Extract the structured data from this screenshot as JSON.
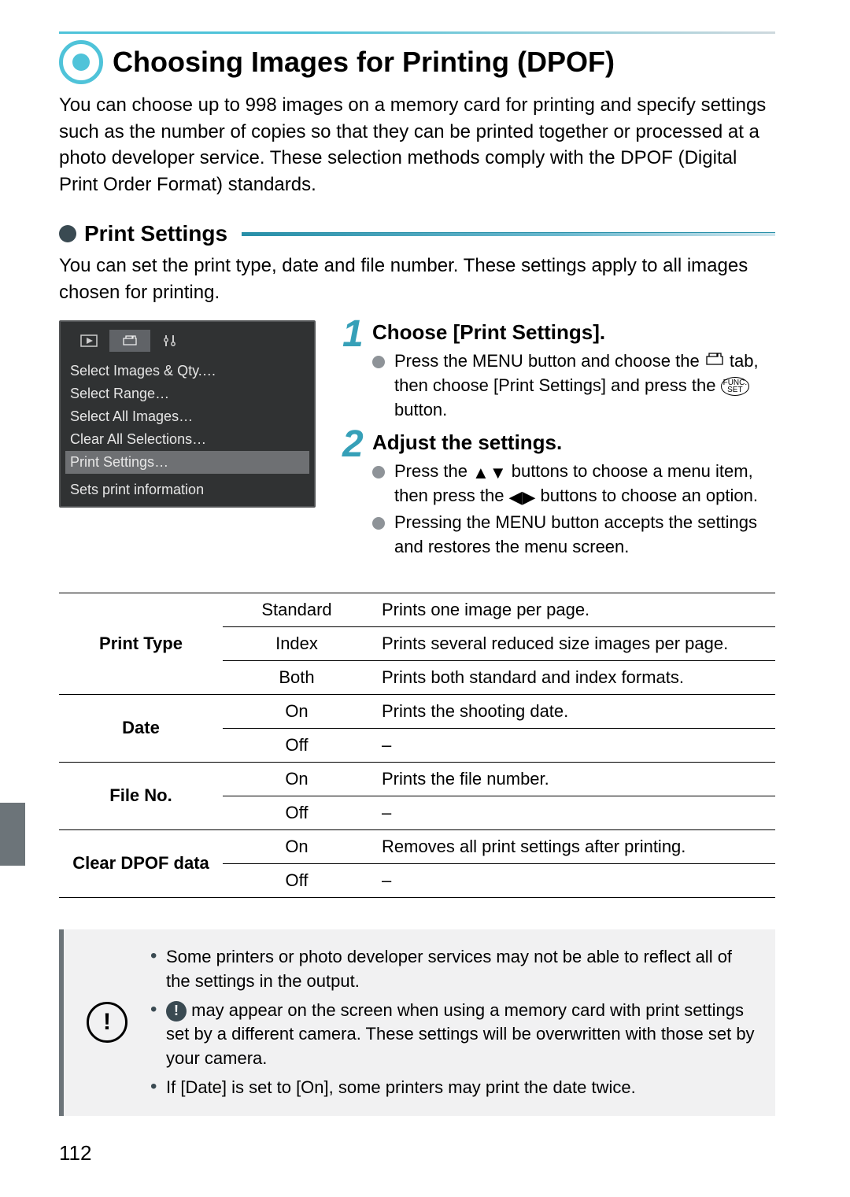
{
  "page_number": "112",
  "main_title": "Choosing Images for Printing (DPOF)",
  "intro": "You can choose up to 998 images on a memory card for printing and specify settings such as the number of copies so that they can be printed together or processed at a photo developer service. These selection methods comply with the DPOF (Digital Print Order Format) standards.",
  "section": {
    "title": "Print Settings",
    "intro": "You can set the print type, date and file number. These settings apply to all images chosen for printing."
  },
  "camera_menu": {
    "items": [
      "Select Images & Qty.",
      "Select Range",
      "Select All Images",
      "Clear All Selections",
      "Print Settings"
    ],
    "active_index": 4,
    "footer": "Sets print information",
    "ellipsis": "…"
  },
  "steps": [
    {
      "num": "1",
      "title": "Choose [Print Settings].",
      "body_parts": {
        "a": "Press the ",
        "menu": "MENU",
        "b": " button and choose the ",
        "c": " tab, then choose [Print Settings] and press the ",
        "func": "FUNC.\nSET",
        "d": " button."
      }
    },
    {
      "num": "2",
      "title": "Adjust the settings.",
      "line1": {
        "a": "Press the ",
        "b": " buttons to choose a menu item, then press the ",
        "c": " buttons to choose an option."
      },
      "line2": {
        "a": "Pressing the ",
        "menu": "MENU",
        "b": " button accepts the settings and restores the menu screen."
      }
    }
  ],
  "table": [
    {
      "cat": "Print Type",
      "rows": [
        {
          "opt": "Standard",
          "desc": "Prints one image per page."
        },
        {
          "opt": "Index",
          "desc": "Prints several reduced size images per page."
        },
        {
          "opt": "Both",
          "desc": "Prints both standard and index formats."
        }
      ]
    },
    {
      "cat": "Date",
      "rows": [
        {
          "opt": "On",
          "desc": "Prints the shooting date."
        },
        {
          "opt": "Off",
          "desc": "–"
        }
      ]
    },
    {
      "cat": "File No.",
      "rows": [
        {
          "opt": "On",
          "desc": "Prints the file number."
        },
        {
          "opt": "Off",
          "desc": "–"
        }
      ]
    },
    {
      "cat": "Clear DPOF data",
      "rows": [
        {
          "opt": "On",
          "desc": "Removes all print settings after printing."
        },
        {
          "opt": "Off",
          "desc": "–"
        }
      ]
    }
  ],
  "warnings": {
    "w1": "Some printers or photo developer services may not be able to reflect all of the settings in the output.",
    "w2a": " may appear on the screen when using a memory card with print settings set by a different camera. These settings will be overwritten with those set by your camera.",
    "w3": "If [Date] is set to [On], some printers may print the date twice.",
    "info_glyph": "!"
  }
}
